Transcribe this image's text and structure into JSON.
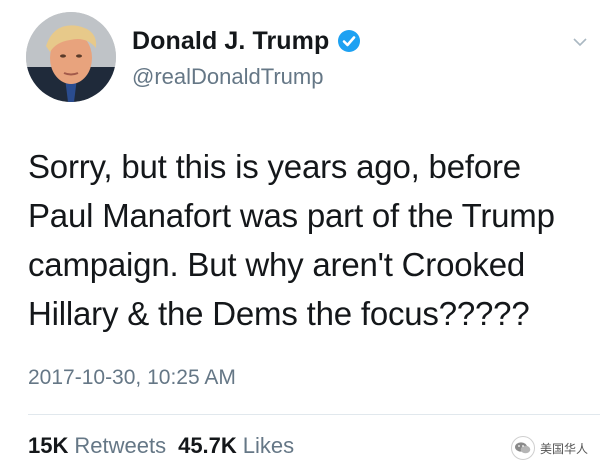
{
  "tweet": {
    "display_name": "Donald J. Trump",
    "handle": "@realDonaldTrump",
    "verified_icon": "verified-badge-icon",
    "caret_icon": "chevron-down-icon",
    "text_lines": [
      "Sorry, but this is years ago, before",
      "Paul Manafort was part of the Trump",
      "campaign. But why aren't Crooked",
      "Hillary & the Dems the focus?????"
    ],
    "timestamp": "2017-10-30, 10:25 AM",
    "retweets_count": "15K",
    "retweets_label": "Retweets",
    "likes_count": "45.7K",
    "likes_label": "Likes"
  },
  "watermark": {
    "text": "美国华人"
  },
  "colors": {
    "text": "#14171a",
    "secondary": "#657786",
    "verified": "#1da1f2",
    "divider": "#e1e8ed"
  }
}
